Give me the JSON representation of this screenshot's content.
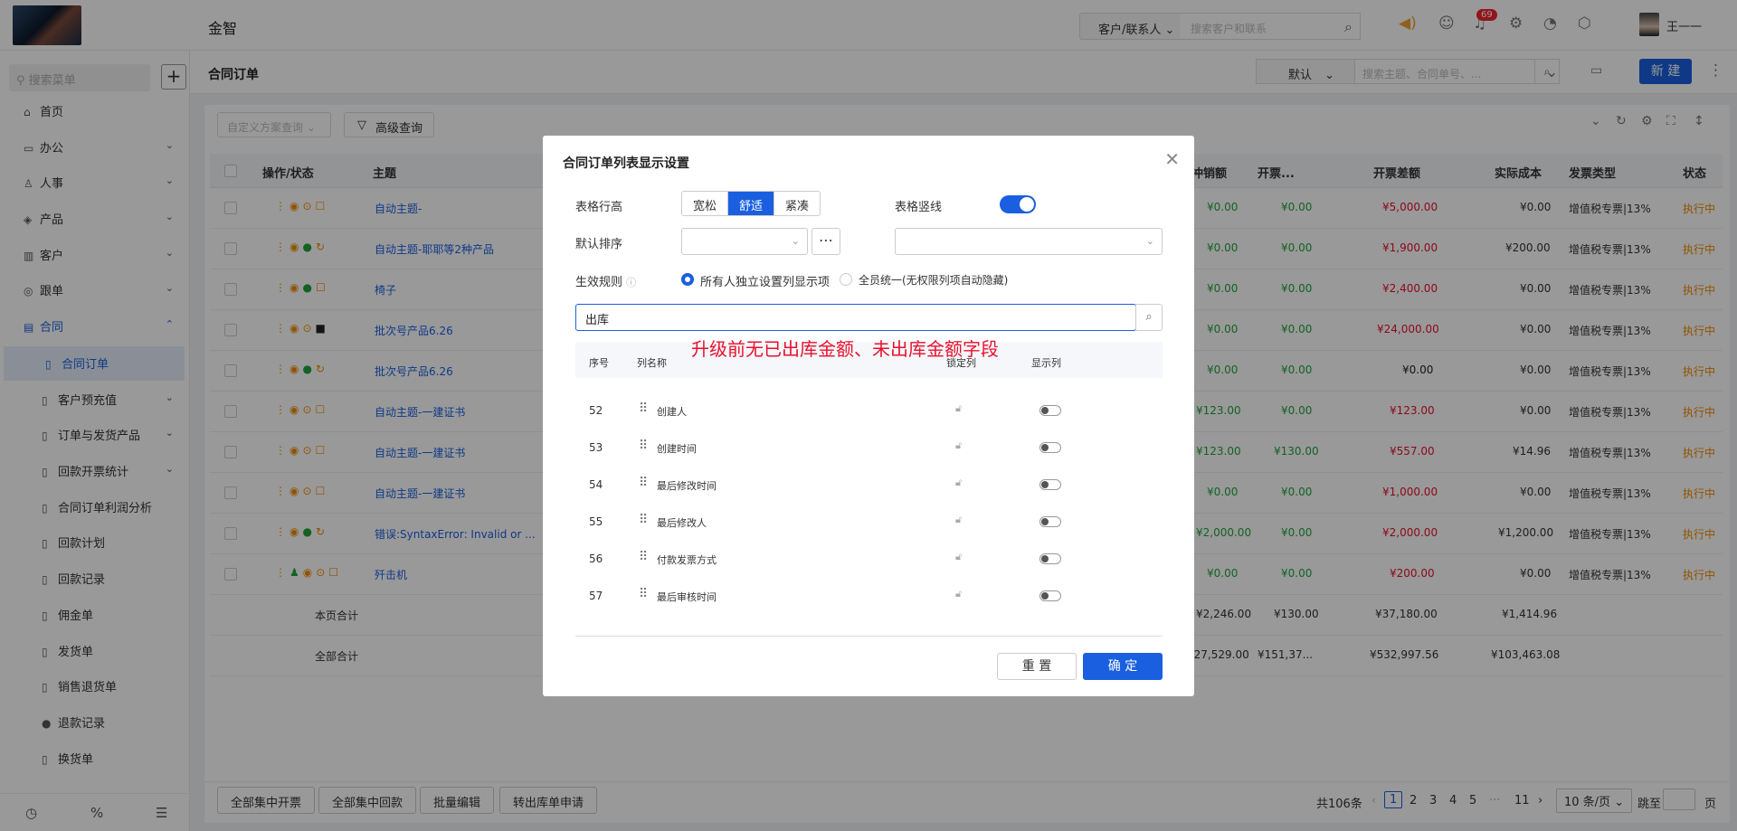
{
  "app": {
    "name": "金智",
    "user": "王一一",
    "notifications": "69"
  },
  "top_search": {
    "category": "客户/联系人",
    "placeholder": "搜索客户和联系"
  },
  "sidebar": {
    "search_placeholder": "搜索菜单",
    "items": [
      {
        "label": "首页",
        "icon": "home-icon"
      },
      {
        "label": "办公",
        "icon": "briefcase-icon"
      },
      {
        "label": "人事",
        "icon": "people-icon"
      },
      {
        "label": "产品",
        "icon": "cube-icon"
      },
      {
        "label": "客户",
        "icon": "customer-icon"
      },
      {
        "label": "跟单",
        "icon": "track-icon"
      },
      {
        "label": "合同",
        "icon": "contract-icon"
      },
      {
        "label": "合同订单",
        "icon": "doc-icon"
      },
      {
        "label": "客户预充值",
        "icon": "wallet-icon"
      },
      {
        "label": "订单与发货产品",
        "icon": "box-icon"
      },
      {
        "label": "回款开票统计",
        "icon": "stats-icon"
      },
      {
        "label": "合同订单利润分析",
        "icon": "analysis-icon"
      },
      {
        "label": "回款计划",
        "icon": "plan-icon"
      },
      {
        "label": "回款记录",
        "icon": "record-icon"
      },
      {
        "label": "佣金单",
        "icon": "commission-icon"
      },
      {
        "label": "发货单",
        "icon": "ship-icon"
      },
      {
        "label": "销售退货单",
        "icon": "return-icon"
      },
      {
        "label": "退款记录",
        "icon": "refund-icon"
      },
      {
        "label": "换货单",
        "icon": "exchange-icon"
      }
    ]
  },
  "page": {
    "title": "合同订单",
    "view_select": "默认",
    "search_placeholder": "搜索主题、合同单号、...",
    "new_button": "新 建",
    "filter_placeholder": "自定义方案查询",
    "advanced_query": "高级查询"
  },
  "table": {
    "headers": [
      "操作/状态",
      "主题",
      "冲销额",
      "开票...",
      "开票差额",
      "实际成本",
      "发票类型",
      "状态"
    ],
    "rows": [
      {
        "subject": "自动主题-",
        "a": "¥0.00",
        "b": "¥0.00",
        "diff": "¥5,000.00",
        "cost": "¥0.00",
        "invoice": "增值税专票|13%",
        "status": "执行中"
      },
      {
        "subject": "自动主题-耶耶等2种产品",
        "a": "¥0.00",
        "b": "¥0.00",
        "diff": "¥1,900.00",
        "cost": "¥200.00",
        "invoice": "增值税专票|13%",
        "status": "执行中"
      },
      {
        "subject": "椅子",
        "a": "¥0.00",
        "b": "¥0.00",
        "diff": "¥2,400.00",
        "cost": "¥0.00",
        "invoice": "增值税专票|13%",
        "status": "执行中"
      },
      {
        "subject": "批次号产品6.26",
        "a": "¥0.00",
        "b": "¥0.00",
        "diff": "¥24,000.00",
        "cost": "¥0.00",
        "invoice": "增值税专票|13%",
        "status": "执行中"
      },
      {
        "subject": "批次号产品6.26",
        "a": "¥0.00",
        "b": "¥0.00",
        "diff": "¥0.00",
        "cost": "¥0.00",
        "invoice": "增值税专票|13%",
        "status": "执行中"
      },
      {
        "subject": "自动主题-一建证书",
        "a": "¥123.00",
        "b": "¥0.00",
        "diff": "¥123.00",
        "cost": "¥0.00",
        "invoice": "增值税专票|13%",
        "status": "执行中"
      },
      {
        "subject": "自动主题-一建证书",
        "a": "¥123.00",
        "b": "¥130.00",
        "diff": "¥557.00",
        "cost": "¥14.96",
        "invoice": "增值税专票|13%",
        "status": "执行中"
      },
      {
        "subject": "自动主题-一建证书",
        "a": "¥0.00",
        "b": "¥0.00",
        "diff": "¥1,000.00",
        "cost": "¥0.00",
        "invoice": "增值税专票|13%",
        "status": "执行中"
      },
      {
        "subject": "错误:SyntaxError: Invalid or ...",
        "a": "¥2,000.00",
        "b": "¥0.00",
        "diff": "¥2,000.00",
        "cost": "¥1,200.00",
        "invoice": "增值税专票|13%",
        "status": "执行中"
      },
      {
        "subject": "歼击机",
        "a": "¥0.00",
        "b": "¥0.00",
        "diff": "¥200.00",
        "cost": "¥0.00",
        "invoice": "增值税专票|13%",
        "status": "执行中"
      }
    ],
    "page_total": {
      "label": "本页合计",
      "a": "¥2,246.00",
      "b": "¥130.00",
      "diff": "¥37,180.00",
      "cost": "¥1,414.96"
    },
    "all_total": {
      "label": "全部合计",
      "a": "¥27,529.00",
      "b": "¥151,37...",
      "diff": "¥532,997.56",
      "cost": "¥103,463.08"
    }
  },
  "bottom": {
    "buttons": [
      "全部集中开票",
      "全部集中回款",
      "批量编辑",
      "转出库单申请"
    ],
    "total": "共106条",
    "pages": [
      "1",
      "2",
      "3",
      "4",
      "5",
      "11"
    ],
    "ellipsis": "···",
    "page_size": "10 条/页",
    "goto": "跳至",
    "page_unit": "页"
  },
  "modal": {
    "title": "合同订单列表显示设置",
    "row_height_label": "表格行高",
    "row_height_options": [
      "宽松",
      "舒适",
      "紧凑"
    ],
    "vline_label": "表格竖线",
    "sort_label": "默认排序",
    "rule_label": "生效规则",
    "rule_opt1": "所有人独立设置列显示项",
    "rule_opt2": "全员统一(无权限列项自动隐藏)",
    "search_value": "出库",
    "annotation": "升级前无已出库金额、未出库金额字段",
    "headers": {
      "no": "序号",
      "name": "列名称",
      "lock": "锁定列",
      "show": "显示列"
    },
    "rows": [
      {
        "no": "52",
        "name": "创建人"
      },
      {
        "no": "53",
        "name": "创建时间"
      },
      {
        "no": "54",
        "name": "最后修改时间"
      },
      {
        "no": "55",
        "name": "最后修改人"
      },
      {
        "no": "56",
        "name": "付款发票方式"
      },
      {
        "no": "57",
        "name": "最后审核时间"
      }
    ],
    "reset": "重 置",
    "confirm": "确 定"
  }
}
